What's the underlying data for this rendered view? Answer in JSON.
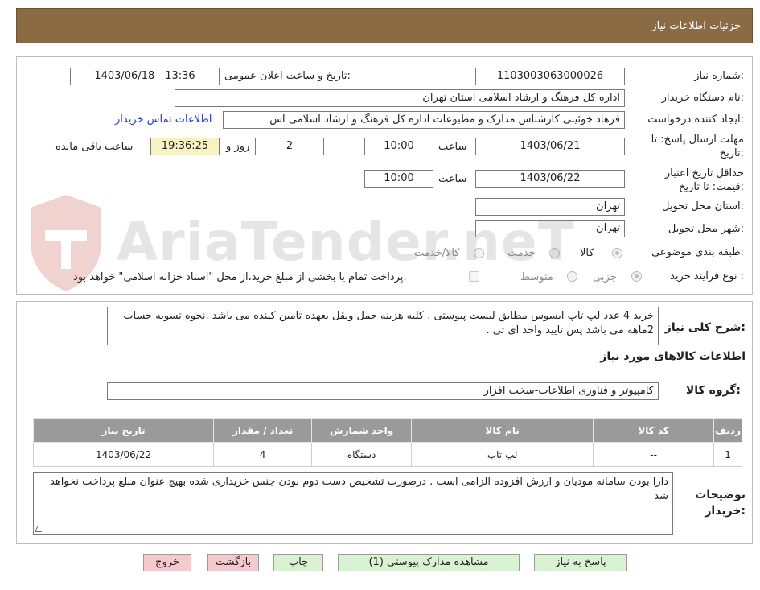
{
  "header": {
    "title": "جزئیات اطلاعات نیاز"
  },
  "form": {
    "need_number_label": "شماره نیاز:",
    "need_number": "1103003063000026",
    "announce_label": "تاریخ و ساعت اعلان عمومی:",
    "announce_value": "1403/06/18 - 13:36",
    "buyer_org_label": "نام دستگاه خریدار:",
    "buyer_org": "اداره کل فرهنگ و ارشاد اسلامی استان تهران",
    "requester_label": "ایجاد کننده درخواست:",
    "requester": "فرهاد خوئینی کارشناس مدارک و مطبوعات اداره کل فرهنگ و ارشاد اسلامی اس",
    "contact_link": "اطلاعات تماس خریدار",
    "deadline_label": "مهلت ارسال پاسخ: تا تاریخ:",
    "deadline_date": "1403/06/21",
    "time_label": "ساعت",
    "deadline_time": "10:00",
    "days_value": "2",
    "days_label": "روز و",
    "remaining_time": "19:36:25",
    "remaining_label": "ساعت باقی مانده",
    "validity_label": "حداقل تاریخ اعتبار قیمت: تا تاریخ:",
    "validity_date": "1403/06/22",
    "validity_time": "10:00",
    "province_label": "استان محل تحویل:",
    "province": "تهران",
    "city_label": "شهر محل تحویل:",
    "city": "تهران",
    "category_label": "طبقه بندی موضوعی:",
    "category_options": [
      "کالا",
      "خدمت",
      "کالا/خدمت"
    ],
    "process_label": "نوع فرآیند خرید :",
    "process_options": [
      "جزیی",
      "متوسط"
    ],
    "payment_note": "پرداخت تمام یا بخشی از مبلغ خرید،از محل \"اسناد خزانه اسلامی\" خواهد بود."
  },
  "details": {
    "description_label": "شرح کلی نیاز:",
    "description": "خرید 4 عدد لپ تاپ ایسوس مطابق لیست پیوستی . کلیه هزینه حمل ونقل بعهده تامین کننده می باشد .نحوه تسویه حساب 2ماهه می باشد پس تایید واحد آی تی .",
    "goods_info_title": "اطلاعات کالاهای مورد نیاز",
    "goods_group_label": "گروه کالا:",
    "goods_group": "کامپیوتر و فناوری اطلاعات-سخت افزار",
    "table_headers": [
      "ردیف",
      "کد کالا",
      "نام کالا",
      "واحد شمارش",
      "تعداد / مقدار",
      "تاریخ نیاز"
    ],
    "table_rows": [
      [
        "1",
        "--",
        "لپ تاپ",
        "دستگاه",
        "4",
        "1403/06/22"
      ]
    ],
    "buyer_notes_label": "توضیحات خریدار:",
    "buyer_notes": "دارا بودن سامانه مودیان و ارزش افزوده الزامی است . درصورت تشخیص دست دوم بودن جنس خریداری شده بهیچ عنوان مبلغ پرداخت نخواهد شد"
  },
  "buttons": {
    "reply": "پاسخ به نیاز",
    "attachments": "مشاهده مدارک پیوستی (1)",
    "print": "چاپ",
    "back": "بازگشت",
    "exit": "خروج"
  },
  "watermark": {
    "text": "AriaTender.neT"
  },
  "colors": {
    "header": "#8b6b44",
    "button_green": "#d9f2d2",
    "button_pink": "#f7c9cf",
    "table_header": "#9a9a9a",
    "highlight": "#f7f2c4",
    "link": "#1f3fd0"
  }
}
